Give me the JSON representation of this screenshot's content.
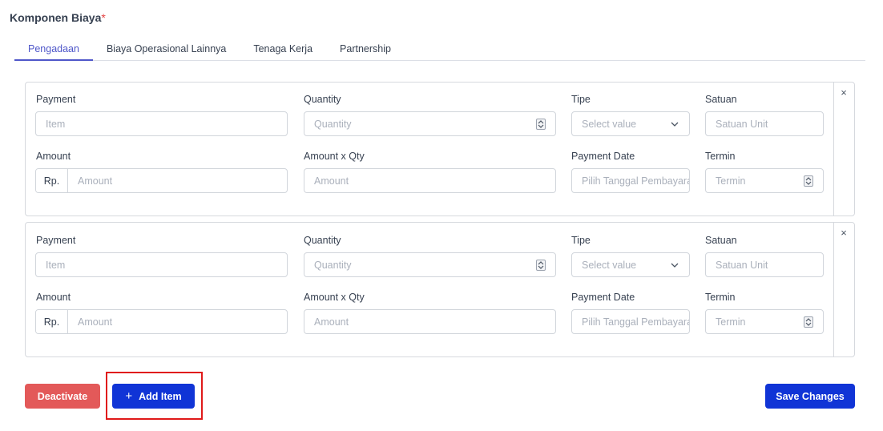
{
  "section": {
    "title": "Komponen Biaya",
    "required_mark": "*"
  },
  "tabs": [
    {
      "label": "Pengadaan",
      "active": true
    },
    {
      "label": "Biaya Operasional Lainnya",
      "active": false
    },
    {
      "label": "Tenaga Kerja",
      "active": false
    },
    {
      "label": "Partnership",
      "active": false
    }
  ],
  "form_labels": {
    "payment": "Payment",
    "quantity": "Quantity",
    "tipe": "Tipe",
    "satuan": "Satuan",
    "amount": "Amount",
    "amount_x_qty": "Amount x Qty",
    "payment_date": "Payment Date",
    "termin": "Termin"
  },
  "placeholders": {
    "item": "Item",
    "quantity": "Quantity",
    "tipe": "Select value",
    "satuan": "Satuan Unit",
    "currency_prefix": "Rp.",
    "amount": "Amount",
    "amount_x_qty": "Amount",
    "payment_date": "Pilih Tanggal Pembayaran",
    "termin": "Termin"
  },
  "remove_icon": "close-icon",
  "remove_glyph": "×",
  "actions": {
    "deactivate": "Deactivate",
    "add_item": "Add Item",
    "add_item_glyph": "+",
    "save": "Save Changes"
  },
  "colors": {
    "accent_tab": "#4f57c9",
    "primary": "#1034d6",
    "danger": "#e35959",
    "highlight": "#e01a1a"
  }
}
